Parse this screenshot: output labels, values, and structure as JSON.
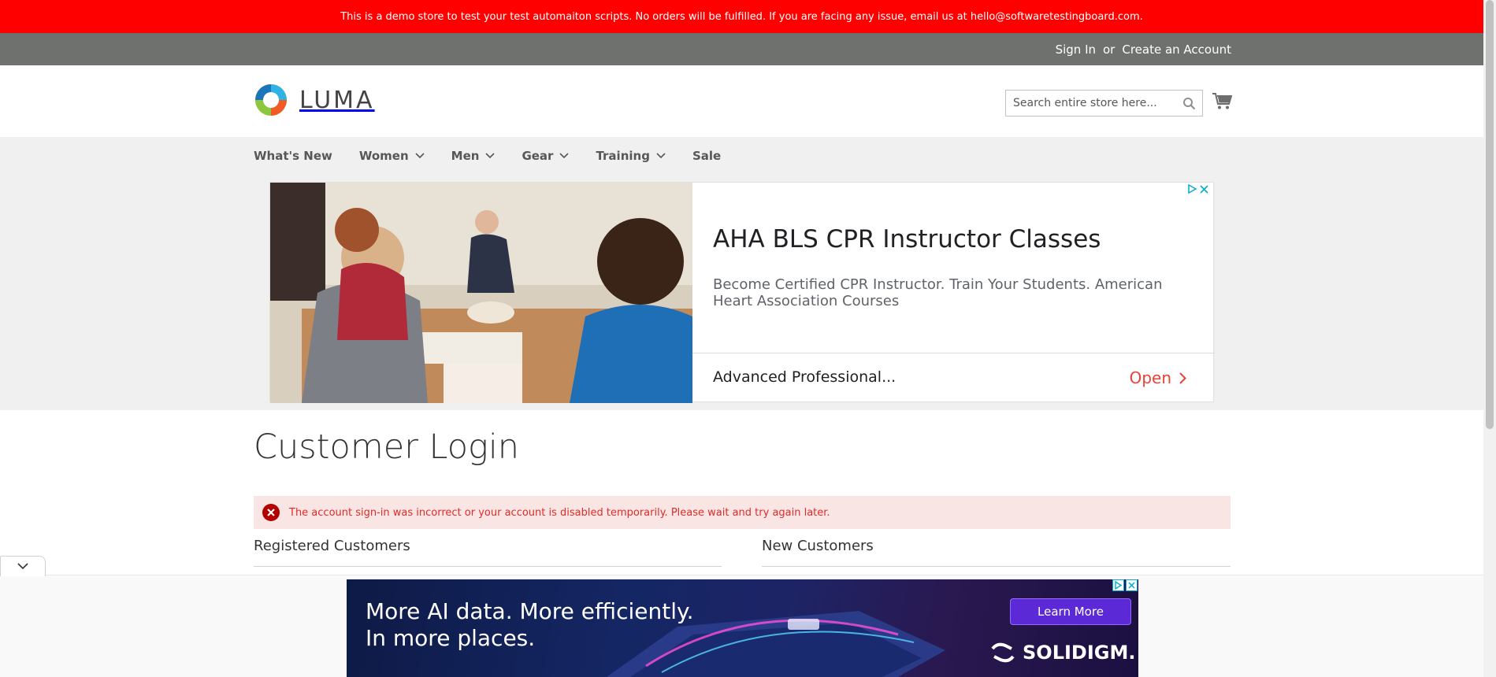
{
  "notice": {
    "text": "This is a demo store to test your test automaiton scripts. No orders will be fulfilled. If you are facing any issue, email us at hello@softwaretestingboard.com."
  },
  "header_links": {
    "sign_in": "Sign In",
    "or": "or",
    "create_account": "Create an Account"
  },
  "logo": {
    "text": "LUMA"
  },
  "search": {
    "placeholder": "Search entire store here..."
  },
  "nav": {
    "items": [
      {
        "label": "What's New",
        "has_dropdown": false
      },
      {
        "label": "Women",
        "has_dropdown": true
      },
      {
        "label": "Men",
        "has_dropdown": true
      },
      {
        "label": "Gear",
        "has_dropdown": true
      },
      {
        "label": "Training",
        "has_dropdown": true
      },
      {
        "label": "Sale",
        "has_dropdown": false
      }
    ]
  },
  "ad": {
    "title": "AHA BLS CPR Instructor Classes",
    "description": "Become Certified CPR Instructor. Train Your Students. American Heart Association Courses",
    "bottom_text": "Advanced Professional...",
    "open_label": "Open"
  },
  "page": {
    "title": "Customer Login",
    "error": "The account sign-in was incorrect or your account is disabled temporarily. Please wait and try again later.",
    "registered_title": "Registered Customers",
    "new_title": "New Customers"
  },
  "bottom_ad": {
    "headline_line1": "More AI data. More efficiently.",
    "headline_line2": "In more places.",
    "cta": "Learn More",
    "brand": "SOLIDIGM."
  },
  "colors": {
    "notice_bg": "#ff0000",
    "header_links_bg": "#6e716e",
    "nav_bg": "#f0f0f0",
    "error_bg": "#fae5e5",
    "error_text": "#e02b27",
    "ad_open": "#ea4335"
  }
}
